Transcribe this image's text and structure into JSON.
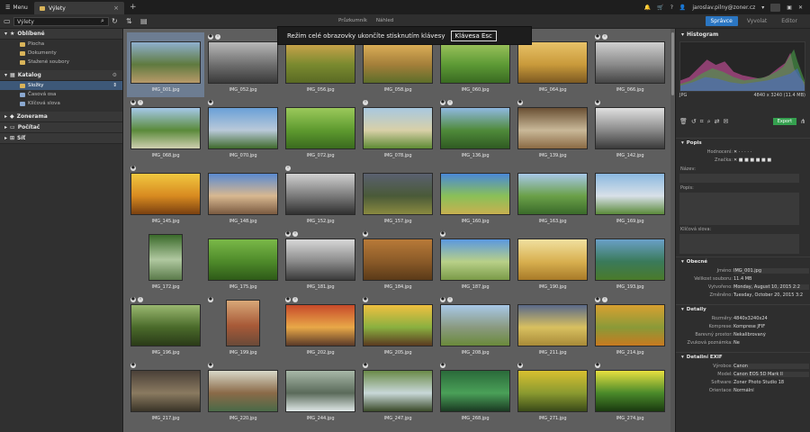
{
  "app": {
    "menu_label": "Menu",
    "tab_title": "Výlety",
    "new_tab": "+"
  },
  "account": {
    "email": "jaroslav.pilny@zoner.cz"
  },
  "search": {
    "value": "Výlety"
  },
  "view_options": [
    "Průzkumník",
    "Náhled"
  ],
  "modes": [
    {
      "label": "Správce",
      "active": true
    },
    {
      "label": "Vyvolat",
      "active": false
    },
    {
      "label": "Editor",
      "active": false
    }
  ],
  "notice": {
    "text": "Režim celé obrazovky ukončíte stisknutím klávesy",
    "key": "Klávesa Esc"
  },
  "sidebar": {
    "favorites": {
      "label": "Oblíbené",
      "items": [
        "Plocha",
        "Dokumenty",
        "Stažené soubory"
      ]
    },
    "catalog": {
      "label": "Katalog",
      "items": [
        "Složky",
        "Časová osa",
        "Klíčová slova"
      ]
    },
    "sections": [
      "Zonerama",
      "Počítač",
      "Síť"
    ]
  },
  "thumbnails": [
    {
      "name": "IMG_001.jpg",
      "o": "h",
      "c": [
        "#8fb0cf",
        "#5f7a3f",
        "#b89a6a"
      ],
      "selected": true
    },
    {
      "name": "IMG_052.jpg",
      "o": "h",
      "c": [
        "#b8b8b8",
        "#6f6f6f",
        "#3a3a3a"
      ],
      "badges": [
        "cam",
        "i"
      ]
    },
    {
      "name": "IMG_056.jpg",
      "o": "h",
      "c": [
        "#d0a54d",
        "#7a8a2f",
        "#5a6a24"
      ]
    },
    {
      "name": "IMG_058.jpg",
      "o": "h",
      "c": [
        "#e1b35a",
        "#a47f3a",
        "#5d6e2a"
      ]
    },
    {
      "name": "IMG_060.jpg",
      "o": "h",
      "c": [
        "#9fc45e",
        "#5d9a35",
        "#3a6a22"
      ]
    },
    {
      "name": "IMG_064.jpg",
      "o": "h",
      "c": [
        "#e8c268",
        "#c99a3b",
        "#7d5a22"
      ]
    },
    {
      "name": "IMG_066.jpg",
      "o": "h",
      "c": [
        "#cfcfcf",
        "#8a8a8a",
        "#444444"
      ],
      "badges": [
        "cam",
        "i"
      ]
    },
    {
      "name": "IMG_068.jpg",
      "o": "h",
      "c": [
        "#a4c8e8",
        "#5a8a3a",
        "#cfcfb0"
      ],
      "badges": [
        "cam",
        "i"
      ]
    },
    {
      "name": "IMG_070.jpg",
      "o": "h",
      "c": [
        "#6aa0d8",
        "#b9c9d9",
        "#3f6a2c"
      ],
      "badges": [
        "cam"
      ]
    },
    {
      "name": "IMG_072.jpg",
      "o": "h",
      "c": [
        "#9bc95b",
        "#5e9a2f",
        "#3a6a1e"
      ]
    },
    {
      "name": "IMG_078.jpg",
      "o": "h",
      "c": [
        "#a8c8e0",
        "#d8d0a8",
        "#5e8a34"
      ],
      "badges": [
        "i"
      ]
    },
    {
      "name": "IMG_136.jpg",
      "o": "h",
      "c": [
        "#8fb8e0",
        "#4f8a3a",
        "#2f5a22"
      ],
      "badges": [
        "cam",
        "i"
      ]
    },
    {
      "name": "IMG_139.jpg",
      "o": "h",
      "c": [
        "#6a5034",
        "#c9b898",
        "#8a6a44"
      ],
      "badges": [
        "cam"
      ]
    },
    {
      "name": "IMG_142.jpg",
      "o": "h",
      "c": [
        "#e0e0e0",
        "#8a8a8a",
        "#3a3a3a"
      ],
      "badges": [
        "cam"
      ]
    },
    {
      "name": "IMG_145.jpg",
      "o": "h",
      "c": [
        "#f0c840",
        "#d88a20",
        "#7a4010"
      ],
      "badges": [
        "cam"
      ]
    },
    {
      "name": "IMG_148.jpg",
      "o": "h",
      "c": [
        "#5a8ad0",
        "#d8b890",
        "#7a5a40"
      ]
    },
    {
      "name": "IMG_152.jpg",
      "o": "h",
      "c": [
        "#d0d0d0",
        "#7a7a7a",
        "#303030"
      ],
      "badges": [
        "i"
      ]
    },
    {
      "name": "IMG_157.jpg",
      "o": "h",
      "c": [
        "#5a6070",
        "#4a5a38",
        "#8a8a40"
      ]
    },
    {
      "name": "IMG_160.jpg",
      "o": "h",
      "c": [
        "#4a88d8",
        "#8ac058",
        "#c8b050"
      ]
    },
    {
      "name": "IMG_163.jpg",
      "o": "h",
      "c": [
        "#a8c8e8",
        "#6aa048",
        "#3a6a2a"
      ]
    },
    {
      "name": "IMG_169.jpg",
      "o": "h",
      "c": [
        "#8ab8e0",
        "#d8e0e8",
        "#5a8a3a"
      ]
    },
    {
      "name": "IMG_172.jpg",
      "o": "v",
      "c": [
        "#3a6a2a",
        "#b0c8a0",
        "#5a7a4a"
      ]
    },
    {
      "name": "IMG_175.jpg",
      "o": "h",
      "c": [
        "#7ab848",
        "#4e8a2a",
        "#2e5a18"
      ]
    },
    {
      "name": "IMG_181.jpg",
      "o": "h",
      "c": [
        "#d8d8d8",
        "#8a8a8a",
        "#3a3a3a"
      ],
      "badges": [
        "cam",
        "i"
      ]
    },
    {
      "name": "IMG_184.jpg",
      "o": "h",
      "c": [
        "#b87a38",
        "#8a5a28",
        "#5a3a18"
      ],
      "badges": [
        "cam"
      ]
    },
    {
      "name": "IMG_187.jpg",
      "o": "h",
      "c": [
        "#5a98e0",
        "#b8d088",
        "#7a9a48"
      ],
      "badges": [
        "cam"
      ]
    },
    {
      "name": "IMG_190.jpg",
      "o": "h",
      "c": [
        "#f0e0a0",
        "#d8b050",
        "#a87a28"
      ]
    },
    {
      "name": "IMG_193.jpg",
      "o": "h",
      "c": [
        "#6aa0c8",
        "#3a7a5a",
        "#4a7a2a"
      ]
    },
    {
      "name": "IMG_196.jpg",
      "o": "h",
      "c": [
        "#9ab870",
        "#4a6a2a",
        "#2a3a18"
      ],
      "badges": [
        "cam",
        "i"
      ]
    },
    {
      "name": "IMG_199.jpg",
      "o": "v",
      "c": [
        "#d8a878",
        "#a85a38",
        "#6a4a38"
      ],
      "badges": [
        "cam"
      ]
    },
    {
      "name": "IMG_202.jpg",
      "o": "h",
      "c": [
        "#c84a2a",
        "#e8a848",
        "#5a3a28"
      ],
      "badges": [
        "cam",
        "i"
      ]
    },
    {
      "name": "IMG_205.jpg",
      "o": "h",
      "c": [
        "#f0c040",
        "#8ab040",
        "#5a3a20"
      ],
      "badges": [
        "cam"
      ]
    },
    {
      "name": "IMG_208.jpg",
      "o": "h",
      "c": [
        "#a8c8e8",
        "#8a9a80",
        "#6a8a3a"
      ],
      "badges": [
        "cam",
        "i"
      ]
    },
    {
      "name": "IMG_211.jpg",
      "o": "h",
      "c": [
        "#5a6a8a",
        "#d8c060",
        "#a88a38"
      ]
    },
    {
      "name": "IMG_214.jpg",
      "o": "h",
      "c": [
        "#d8a030",
        "#8a9a38",
        "#c87a20"
      ],
      "badges": [
        "cam",
        "i"
      ]
    },
    {
      "name": "IMG_217.jpg",
      "o": "h",
      "c": [
        "#4a4038",
        "#8a7a60",
        "#3a3428"
      ],
      "badges": [
        "cam"
      ]
    },
    {
      "name": "IMG_220.jpg",
      "o": "h",
      "c": [
        "#d8d8c8",
        "#8a6a48",
        "#4a6a48"
      ],
      "badges": [
        "cam"
      ]
    },
    {
      "name": "IMG_244.jpg",
      "o": "h",
      "c": [
        "#a8b8a8",
        "#5a6a5a",
        "#e0e8e8"
      ]
    },
    {
      "name": "IMG_247.jpg",
      "o": "h",
      "c": [
        "#6a8a48",
        "#c8d8d8",
        "#3a4a2a"
      ],
      "badges": [
        "cam"
      ]
    },
    {
      "name": "IMG_268.jpg",
      "o": "h",
      "c": [
        "#2a6a3a",
        "#4aa058",
        "#1a3a22"
      ],
      "badges": [
        "cam"
      ]
    },
    {
      "name": "IMG_271.jpg",
      "o": "h",
      "c": [
        "#d8c030",
        "#8a9a30",
        "#3a4a18"
      ],
      "badges": [
        "cam"
      ]
    },
    {
      "name": "IMG_274.jpg",
      "o": "h",
      "c": [
        "#e8e040",
        "#4a8a2a",
        "#1a3a10"
      ],
      "badges": [
        "cam"
      ]
    }
  ],
  "panel": {
    "histogram_label": "Histogram",
    "format": "JPG",
    "dimensions": "4840 x 3240 (11.4 MB)",
    "export_label": "Export",
    "popis": {
      "label": "Popis",
      "rating_label": "Hodnocení:",
      "tag_label": "Značka:",
      "name_label": "Název:",
      "desc_label": "Popis:",
      "keywords_label": "Klíčová slova:"
    },
    "general": {
      "label": "Obecné",
      "fields": [
        {
          "k": "Jméno:",
          "v": "IMG_001.jpg",
          "hl": true
        },
        {
          "k": "Velikost souboru:",
          "v": "11.4 MB"
        },
        {
          "k": "Vytvořeno:",
          "v": "Monday, August 10, 2015 2:2",
          "hl": true
        },
        {
          "k": "Změněno:",
          "v": "Tuesday, October 20, 2015 3:2"
        }
      ]
    },
    "details": {
      "label": "Detaily",
      "fields": [
        {
          "k": "Rozměry:",
          "v": "4840x3240x24"
        },
        {
          "k": "Komprese:",
          "v": "Komprese JFIF"
        },
        {
          "k": "Barevný prostor:",
          "v": "Nekalibrovaný"
        },
        {
          "k": "Zvuková poznámka:",
          "v": "Ne"
        }
      ]
    },
    "exif": {
      "label": "Detailní EXIF",
      "fields": [
        {
          "k": "Výrobce:",
          "v": "Canon",
          "hl": true
        },
        {
          "k": "Model:",
          "v": "Canon EOS 5D Mark II",
          "hl": true
        },
        {
          "k": "Software:",
          "v": "Zoner Photo Studio 18"
        },
        {
          "k": "Orientace:",
          "v": "Normální"
        }
      ]
    }
  },
  "colors": {
    "accent": "#2b76c2",
    "export": "#35a04f",
    "selection": "#6d7d92"
  }
}
